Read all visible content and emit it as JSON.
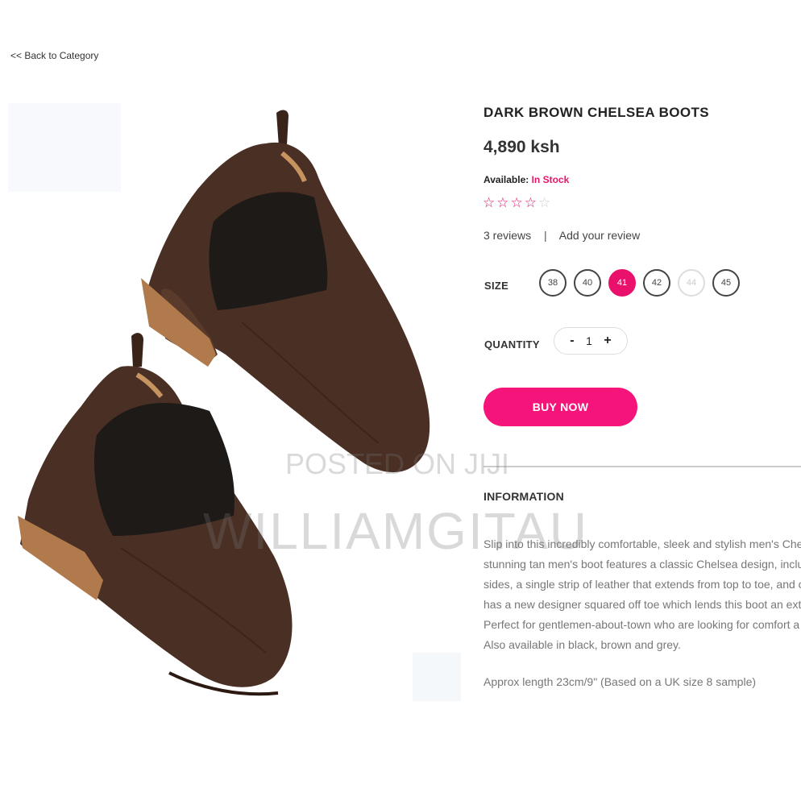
{
  "nav": {
    "back_label": "<< Back to Category"
  },
  "product": {
    "title": "DARK BROWN CHELSEA BOOTS",
    "price": "4,890 ksh",
    "availability_label": "Available:",
    "availability_value": "In Stock",
    "rating": 4,
    "rating_max": 5,
    "reviews_label": "3 reviews",
    "review_separator": "|",
    "add_review_label": "Add your review",
    "image_icon": "chelsea-boots-photo"
  },
  "size": {
    "label": "SIZE",
    "options": [
      "38",
      "40",
      "41",
      "42",
      "44",
      "45"
    ],
    "selected": "41",
    "unavailable": [
      "44"
    ]
  },
  "quantity": {
    "label": "QUANTITY",
    "minus": "-",
    "value": "1",
    "plus": "+"
  },
  "buy_label": "BUY NOW",
  "information": {
    "heading": "INFORMATION",
    "description_lines": [
      "Slip into this incredibly comfortable, sleek and stylish men's Che",
      "stunning tan men's boot features a classic Chelsea design, inclu",
      "sides, a single strip of leather that extends from top to toe, and c",
      "has a new designer squared off toe which lends this boot an ext",
      "Perfect for gentlemen-about-town who are looking for comfort a",
      "Also available in black, brown and grey."
    ],
    "approx": "Approx length 23cm/9\" (Based on a UK size 8 sample)"
  },
  "watermark": {
    "line1": "POSTED ON JIJI",
    "line2": "WILLIAMGITAU"
  },
  "colors": {
    "accent": "#e9116b",
    "button": "#f5157a",
    "boot": "#4a3024",
    "sole": "#b07a4c",
    "elastic": "#1e1a18"
  }
}
